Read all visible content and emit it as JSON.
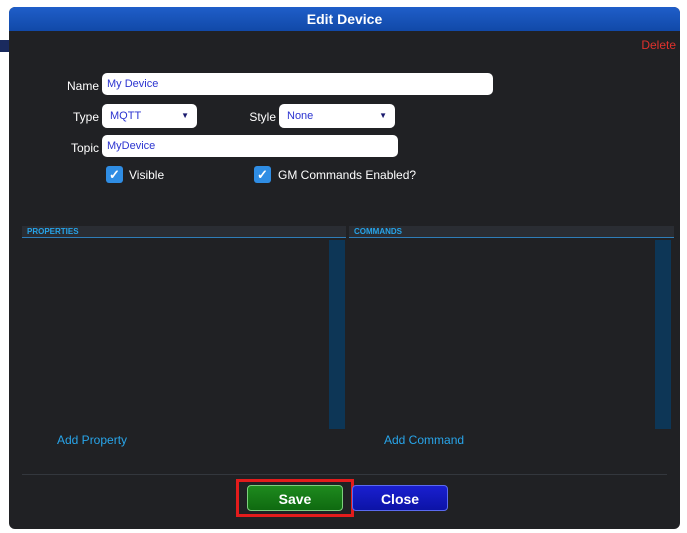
{
  "dialog": {
    "title": "Edit Device",
    "delete_label": "Delete"
  },
  "form": {
    "name_label": "Name",
    "name_value": "My Device",
    "type_label": "Type",
    "type_value": "MQTT",
    "style_label": "Style",
    "style_value": "None",
    "topic_label": "Topic",
    "topic_value": "MyDevice",
    "visible_label": "Visible",
    "visible_checked": true,
    "gm_label": "GM Commands Enabled?",
    "gm_checked": true,
    "dropdown_glyph": "▼",
    "check_glyph": "✓"
  },
  "panels": {
    "properties_header": "PROPERTIES",
    "commands_header": "COMMANDS",
    "add_property": "Add Property",
    "add_command": "Add Command"
  },
  "buttons": {
    "save": "Save",
    "close": "Close"
  },
  "colors": {
    "titlebar": "#1f5ec9",
    "background": "#202124",
    "accent_link": "#28a5ea",
    "delete": "#e0312c",
    "save": "#1e8a1e",
    "close": "#1a1fd0",
    "highlight": "#e31c1c"
  }
}
